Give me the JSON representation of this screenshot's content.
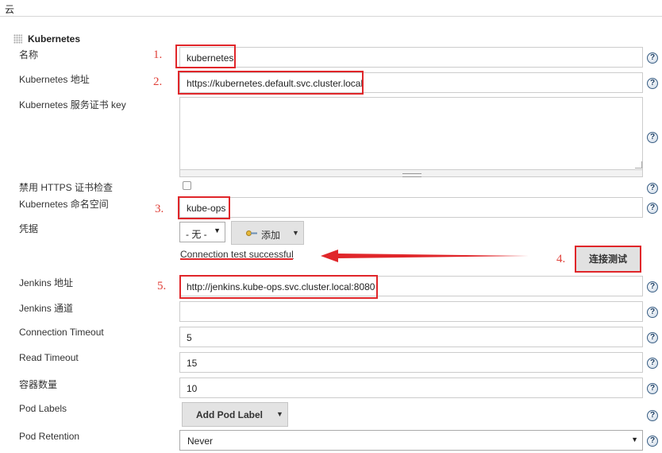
{
  "section": {
    "title": "云"
  },
  "cloud": {
    "name": "Kubernetes"
  },
  "fields": {
    "name": {
      "label": "名称",
      "value": "kubernetes",
      "step": "1."
    },
    "k8s_url": {
      "label": "Kubernetes 地址",
      "value": "https://kubernetes.default.svc.cluster.local",
      "step": "2."
    },
    "cert_key": {
      "label": "Kubernetes 服务证书 key",
      "value": ""
    },
    "disable_https": {
      "label": "禁用 HTTPS 证书检查",
      "checked": false
    },
    "namespace": {
      "label": "Kubernetes 命名空间",
      "value": "kube-ops",
      "step": "3."
    },
    "credentials": {
      "label": "凭据",
      "selected": "- 无 -",
      "add_label": "添加"
    },
    "connection_status": "Connection test successful",
    "test_button": {
      "label": "连接测试",
      "step": "4."
    },
    "jenkins_url": {
      "label": "Jenkins 地址",
      "value": "http://jenkins.kube-ops.svc.cluster.local:8080",
      "step": "5."
    },
    "jenkins_tunnel": {
      "label": "Jenkins 通道",
      "value": ""
    },
    "connection_timeout": {
      "label": "Connection Timeout",
      "value": "5"
    },
    "read_timeout": {
      "label": "Read Timeout",
      "value": "15"
    },
    "container_cap": {
      "label": "容器数量",
      "value": "10"
    },
    "pod_labels": {
      "label": "Pod Labels",
      "add_label": "Add Pod Label"
    },
    "pod_retention": {
      "label": "Pod Retention",
      "selected": "Never"
    }
  },
  "help_glyph": "?",
  "icons": {
    "help": "help-icon",
    "key": "key-icon",
    "dropdown": "caret-down-icon",
    "arrow": "red-arrow"
  },
  "colors": {
    "annotation": "#e0262a",
    "help_icon": "#3a5f85"
  }
}
